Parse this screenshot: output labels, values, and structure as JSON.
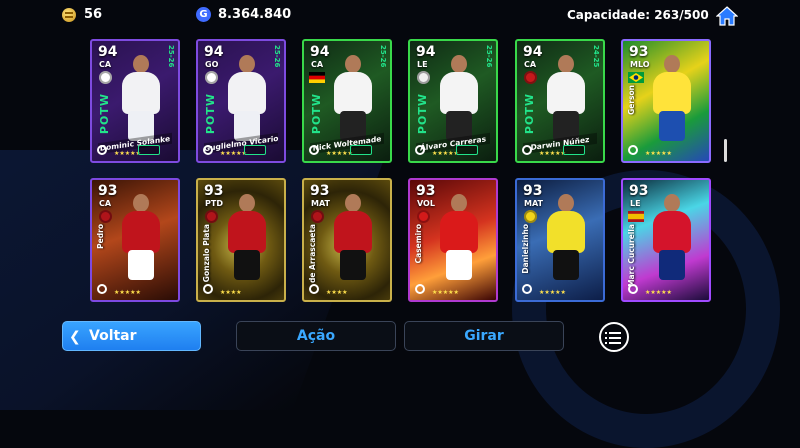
{
  "header": {
    "coins": "56",
    "gp": "8.364.840",
    "gp_icon_letter": "G",
    "capacity": "Capacidade: 263/500"
  },
  "cards": [
    {
      "rating": "94",
      "position": "CA",
      "name": "Dominic Solanke",
      "potw": "POTW",
      "season": "25-26",
      "stars": "★★★★★",
      "club": "Tottenham",
      "theme": "purple-potw"
    },
    {
      "rating": "94",
      "position": "GO",
      "name": "Guglielmo Vicario",
      "potw": "POTW",
      "season": "25-26",
      "stars": "★★★★★",
      "club": "Tottenham",
      "theme": "purple-potw"
    },
    {
      "rating": "94",
      "position": "CA",
      "name": "Nick Woltemade",
      "potw": "POTW",
      "season": "25-26",
      "stars": "★★★★★",
      "club": "Germany",
      "theme": "green-potw"
    },
    {
      "rating": "94",
      "position": "LE",
      "name": "Álvaro Carreras",
      "potw": "POTW",
      "season": "25-26",
      "stars": "★★★★★",
      "club": "Real Madrid",
      "theme": "green-potw"
    },
    {
      "rating": "94",
      "position": "CA",
      "name": "Darwin Núñez",
      "potw": "POTW",
      "season": "24-25",
      "stars": "★★★★★",
      "club": "Al Hilal",
      "theme": "green-potw"
    },
    {
      "rating": "93",
      "position": "MLO",
      "name": "Gerson",
      "potw": "",
      "season": "",
      "stars": "★★★★★",
      "club": "Brazil",
      "theme": "green-yellow"
    },
    {
      "rating": "93",
      "position": "CA",
      "name": "Pedro",
      "potw": "",
      "season": "",
      "stars": "★★★★★",
      "club": "Flamengo",
      "theme": "orange"
    },
    {
      "rating": "93",
      "position": "PTD",
      "name": "Gonzalo Plata",
      "potw": "",
      "season": "",
      "stars": "★★★★",
      "club": "Flamengo",
      "theme": "gold"
    },
    {
      "rating": "93",
      "position": "MAT",
      "name": "de Arrascaeta",
      "potw": "",
      "season": "",
      "stars": "★★★★",
      "club": "Flamengo",
      "theme": "gold"
    },
    {
      "rating": "93",
      "position": "VOL",
      "name": "Casemiro",
      "potw": "",
      "season": "",
      "stars": "★★★★★",
      "club": "Man United",
      "theme": "red"
    },
    {
      "rating": "93",
      "position": "MAT",
      "name": "Danielzinho",
      "potw": "",
      "season": "",
      "stars": "★★★★★",
      "club": "Mirassol",
      "theme": "blue"
    },
    {
      "rating": "93",
      "position": "LE",
      "name": "Marc Cucurella",
      "potw": "",
      "season": "",
      "stars": "★★★★★",
      "club": "Spain",
      "theme": "cyan"
    }
  ],
  "buttons": {
    "back": "Voltar",
    "action": "Ação",
    "rotate": "Girar"
  },
  "colors": {
    "accent": "#1f7ff0",
    "potw_green": "#22e38a",
    "ghost_text": "#3aa8ff"
  }
}
